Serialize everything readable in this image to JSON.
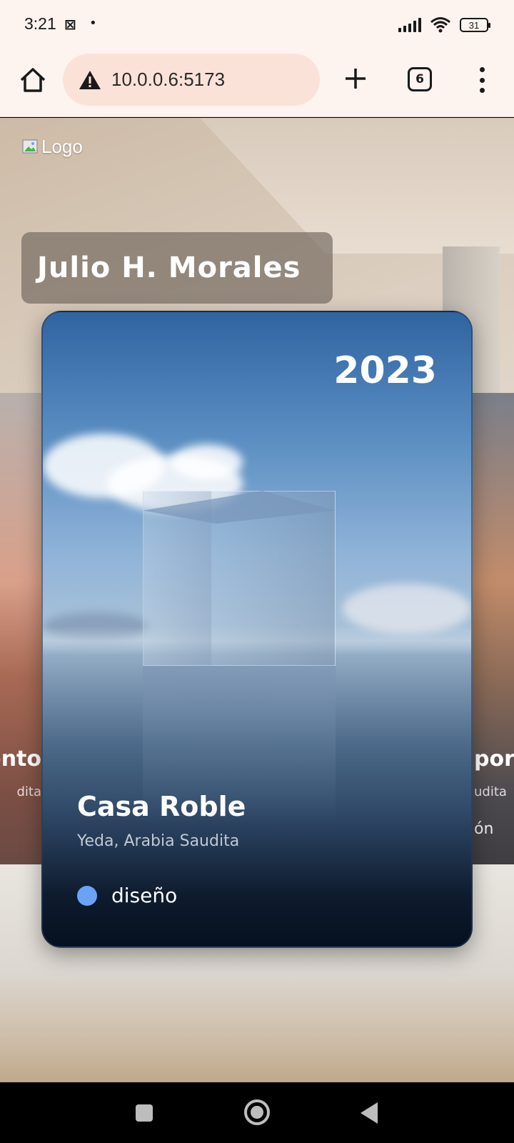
{
  "status_bar": {
    "time": "3:21",
    "app_icon": "capcut-icon",
    "battery": "31"
  },
  "browser": {
    "url": "10.0.0.6:5173",
    "tab_count": "6"
  },
  "page": {
    "logo_alt": "Logo",
    "name": "Julio H. Morales",
    "left_card": {
      "title": "ento",
      "subtitle": "dita"
    },
    "right_card": {
      "title": "pora",
      "subtitle": "udita",
      "tag": "ón"
    },
    "project": {
      "year": "2023",
      "title": "Casa Roble",
      "location": "Yeda, Arabia Saudita",
      "tag": "diseño",
      "tag_color": "#6aa3f5"
    }
  }
}
